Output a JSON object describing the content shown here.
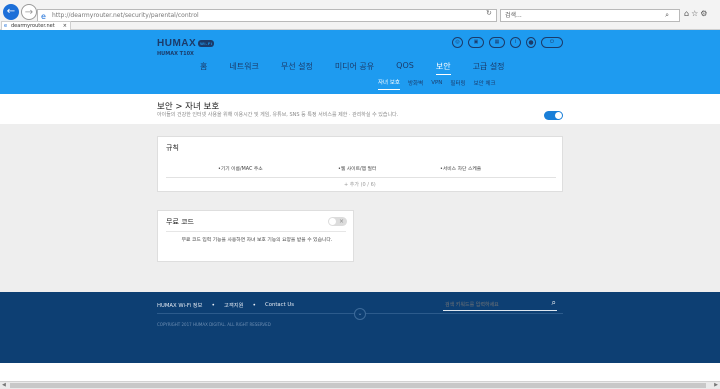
{
  "browser": {
    "back_icon": "back-arrow-icon",
    "url": "http://dearmyrouter.net/security/parental/control",
    "search_placeholder": "검색...",
    "tab_title": "dearmyrouter.net"
  },
  "header": {
    "logo": "HUMAX",
    "logo_badge": "Wi-Fi",
    "model": "HUMAX T10X",
    "icons": [
      "globe-icon",
      "mobile-icon",
      "network-icon",
      "info-icon",
      "settings-icon",
      "power-icon"
    ],
    "menu": [
      "홈",
      "네트워크",
      "무선 설정",
      "미디어 공유",
      "QOS",
      "보안",
      "고급 설정"
    ],
    "active_menu": "보안",
    "submenu": [
      "자녀 보호",
      "방화벽",
      "VPN",
      "필터링",
      "보안 체크"
    ],
    "active_submenu": "자녀 보호",
    "brand_color": "#1e9bf0"
  },
  "main": {
    "title": "보안 > 자녀 보호",
    "description": "아이들의 건강한 인터넷 사용을 위해 이용시간 및 게임, 유튜브, SNS 등 특정 서비스를 제한 · 관리하실 수 있습니다.",
    "enabled": true,
    "rules": {
      "title": "규칙",
      "columns": [
        "•기기 이름/MAC 주소",
        "•웹 사이트/앱 필터",
        "•서비스 차단 스케줄"
      ],
      "add_label": "+ 추가 (0 / 6)"
    },
    "nocode": {
      "title": "무료 코드",
      "enabled": false,
      "description": "무료 코드 입력 기능을 사용하면 자녀 보호 기능의 요양을 받을 수 있습니다."
    }
  },
  "footer": {
    "links": [
      "HUMAX Wi-Fi 정보",
      "고객지원",
      "Contact Us"
    ],
    "search_placeholder": "검색 키워드를 입력하세요",
    "copyright": "COPYRIGHT 2017 HUMAX DIGITAL. ALL RIGHT RESERVED",
    "color": "#0d3f73"
  }
}
